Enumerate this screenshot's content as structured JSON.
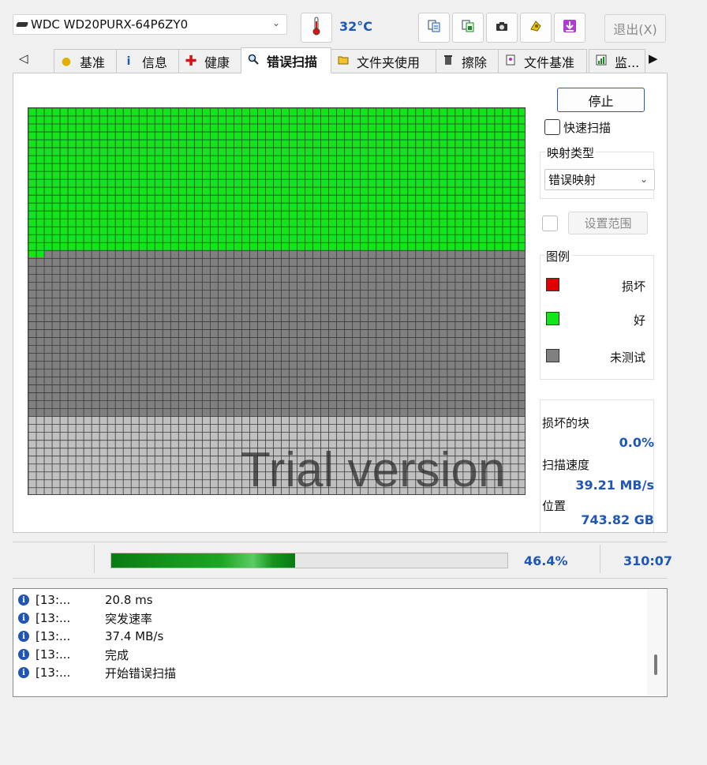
{
  "toolbar": {
    "drive": "WDC WD20PURX-64P6ZY0",
    "temperature": "32°C",
    "exit_label": "退出(X)",
    "buttons": [
      "copy-text-icon",
      "copy-image-icon",
      "screenshot-icon",
      "save-icon",
      "download-icon"
    ]
  },
  "tabs": [
    {
      "label": "基准",
      "icon": "bulb-icon"
    },
    {
      "label": "信息",
      "icon": "info-icon"
    },
    {
      "label": "健康",
      "icon": "health-cross-icon"
    },
    {
      "label": "错误扫描",
      "icon": "magnifier-icon",
      "active": true
    },
    {
      "label": "文件夹使用",
      "icon": "folder-icon"
    },
    {
      "label": "擦除",
      "icon": "trash-icon"
    },
    {
      "label": "文件基准",
      "icon": "file-icon"
    },
    {
      "label": "监...",
      "icon": "chart-icon"
    }
  ],
  "scan": {
    "stop_label": "停止",
    "quick_scan_label": "快速扫描",
    "quick_scan_checked": false,
    "map_type_label": "映射类型",
    "map_type_value": "错误映射",
    "range_label": "设置范围",
    "legend_title": "图例",
    "legend": [
      {
        "label": "损坏",
        "color": "#e00000"
      },
      {
        "label": "好",
        "color": "#12e51a"
      },
      {
        "label": "未测试",
        "color": "#808080"
      }
    ],
    "damaged_blocks_label": "损坏的块",
    "damaged_blocks_value": "0.0%",
    "scan_speed_label": "扫描速度",
    "scan_speed_value": "39.21 MB/s",
    "position_label": "位置",
    "position_value": "743.82 GB",
    "watermark": "Trial version",
    "colors": {
      "good": "#12e51a",
      "untested": "#808080",
      "out_of_range": "#c0c0c0",
      "grid_line": "#3a3a3a"
    }
  },
  "status": {
    "progress_fraction": 0.464,
    "progress_text": "46.4%",
    "time_text": "310:07"
  },
  "log": [
    {
      "time": "[13:...",
      "message": "20.8 ms"
    },
    {
      "time": "[13:...",
      "message": "突发速率"
    },
    {
      "time": "[13:...",
      "message": "37.4 MB/s"
    },
    {
      "time": "[13:...",
      "message": "完成"
    },
    {
      "time": "[13:...",
      "message": "开始错误扫描"
    }
  ]
}
